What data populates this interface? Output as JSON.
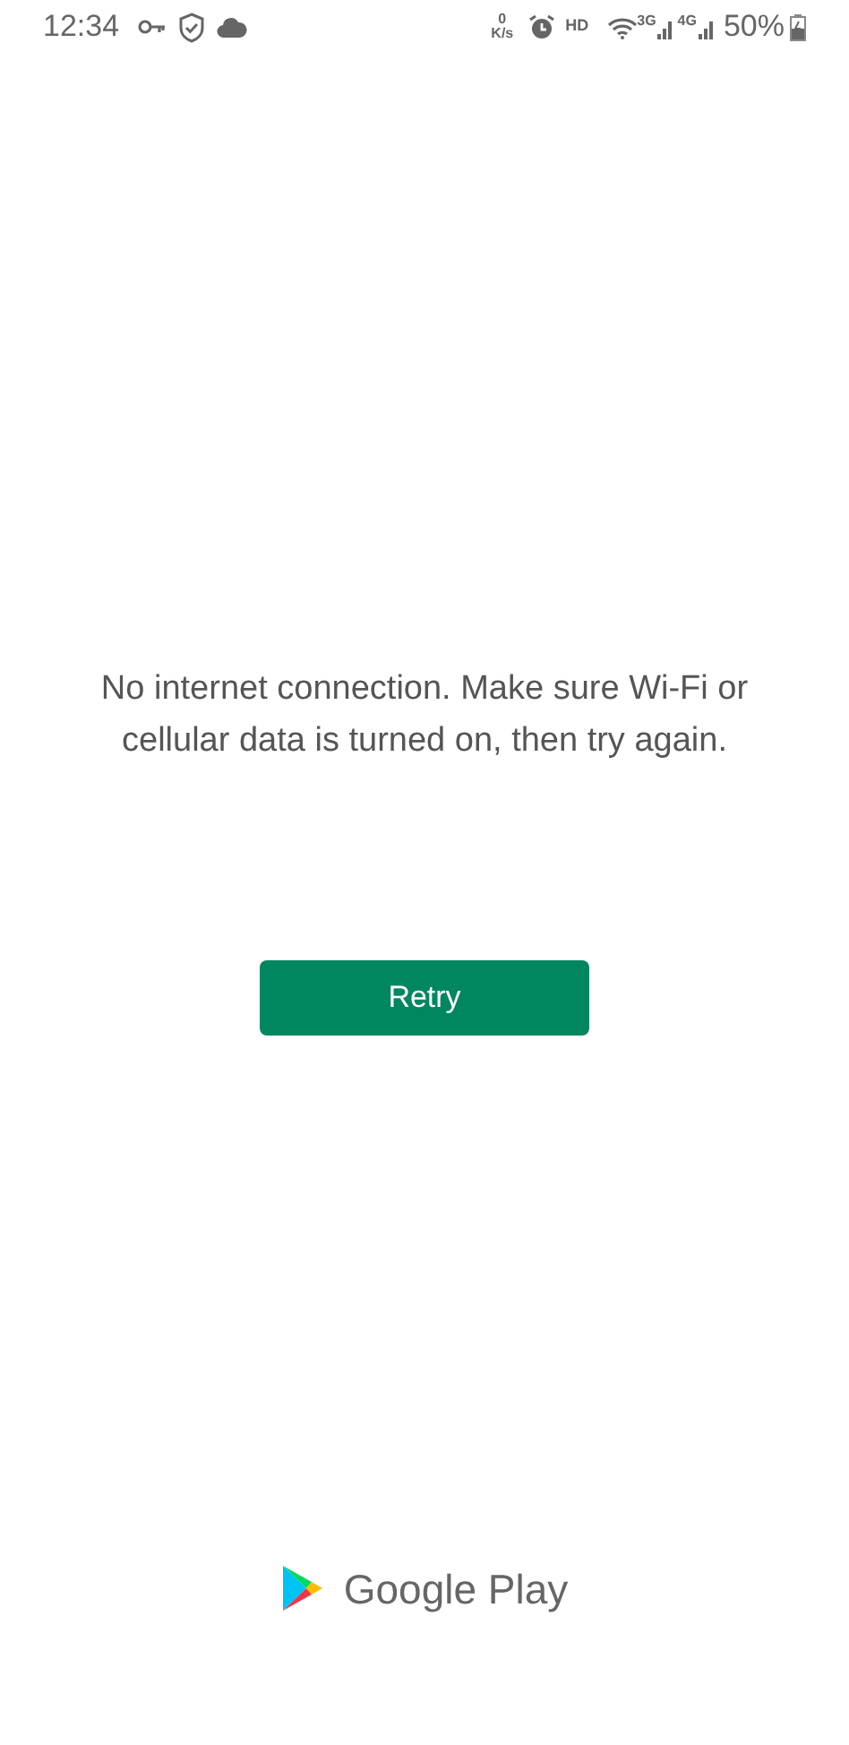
{
  "status_bar": {
    "time": "12:34",
    "speed_value": "0",
    "speed_unit": "K/s",
    "hd": "HD",
    "network_1": "3G",
    "network_2": "4G",
    "battery": "50%"
  },
  "message": "No internet connection. Make sure Wi-Fi or cellular data is turned on, then try again.",
  "retry_button": {
    "label": "Retry"
  },
  "brand": {
    "label": "Google Play"
  }
}
